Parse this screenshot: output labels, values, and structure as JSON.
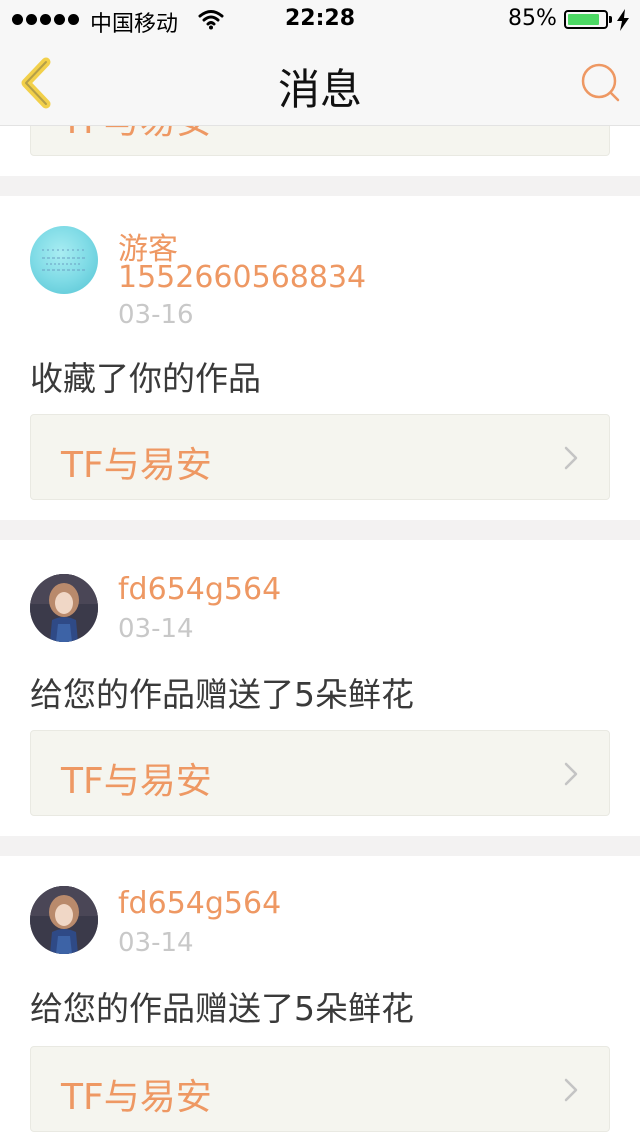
{
  "status_bar": {
    "carrier": "中国移动",
    "time": "22:28",
    "battery_percent": "85%",
    "battery_level": 0.85,
    "icons": [
      "signal-dots-icon",
      "wifi-icon",
      "battery-icon",
      "charging-bolt-icon"
    ]
  },
  "nav": {
    "title": "消息",
    "back_icon": "chevron-left-icon",
    "search_icon": "search-icon"
  },
  "colors": {
    "accent": "#ee9863",
    "back_arrow": "#f2d04a",
    "muted": "#c8c8c8",
    "card_bg": "#f5f5ef",
    "separator": "#f3f2f2",
    "battery_fill": "#4cd964"
  },
  "top_partial_work": {
    "title": "TF与易安"
  },
  "messages": [
    {
      "user": "游客1552660568834",
      "user_line1": "游客",
      "user_line2": "1552660568834",
      "date": "03-16",
      "action": "收藏了你的作品",
      "work_title": "TF与易安"
    },
    {
      "user": "fd654g564",
      "date": "03-14",
      "action": "给您的作品赠送了5朵鲜花",
      "work_title": "TF与易安"
    },
    {
      "user": "fd654g564",
      "date": "03-14",
      "action": "给您的作品赠送了5朵鲜花",
      "work_title": "TF与易安"
    }
  ]
}
